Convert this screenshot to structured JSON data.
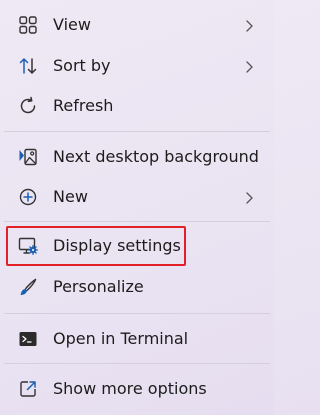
{
  "menu": {
    "items": [
      {
        "label": "View",
        "icon": "grid-icon",
        "has_submenu": true
      },
      {
        "label": "Sort by",
        "icon": "sort-icon",
        "has_submenu": true
      },
      {
        "label": "Refresh",
        "icon": "refresh-icon",
        "has_submenu": false
      },
      {
        "label": "Next desktop background",
        "icon": "next-background-icon",
        "has_submenu": false
      },
      {
        "label": "New",
        "icon": "plus-circle-icon",
        "has_submenu": true
      },
      {
        "label": "Display settings",
        "icon": "display-settings-icon",
        "has_submenu": false,
        "highlighted": true
      },
      {
        "label": "Personalize",
        "icon": "brush-icon",
        "has_submenu": false
      },
      {
        "label": "Open in Terminal",
        "icon": "terminal-icon",
        "has_submenu": false
      },
      {
        "label": "Show more options",
        "icon": "expand-icon",
        "has_submenu": false
      }
    ]
  },
  "colors": {
    "background": "#ece6f4",
    "highlight_border": "#e22028",
    "icon_blue": "#1a5fb4",
    "text": "#1c1c1c"
  }
}
